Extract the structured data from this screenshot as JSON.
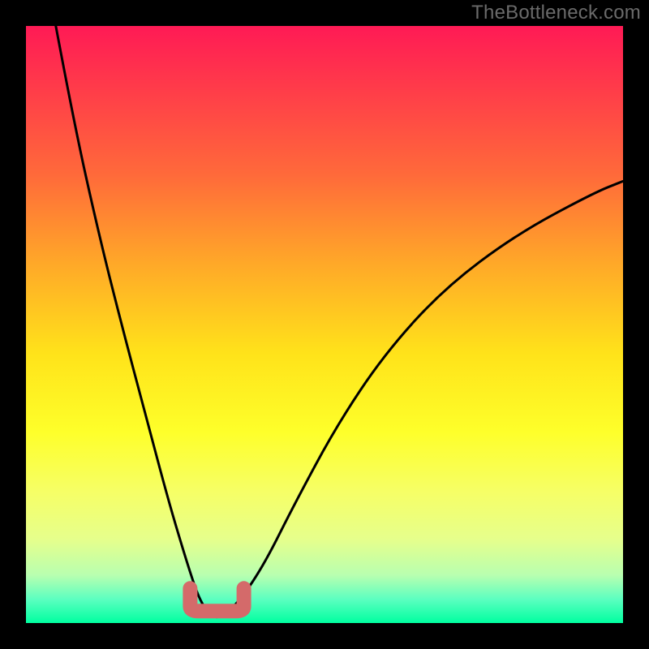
{
  "watermark": "TheBottleneck.com",
  "chart_data": {
    "type": "line",
    "title": "",
    "xlabel": "",
    "ylabel": "",
    "xlim": [
      0,
      100
    ],
    "ylim": [
      0,
      100
    ],
    "grid": false,
    "series": [
      {
        "name": "bottleneck-curve",
        "x": [
          5,
          8,
          12,
          16,
          20,
          24,
          27,
          29,
          31,
          33,
          36,
          40,
          45,
          52,
          60,
          70,
          82,
          95,
          100
        ],
        "values": [
          100,
          84,
          66,
          50,
          35,
          20,
          10,
          4,
          1,
          1,
          4,
          10,
          20,
          33,
          45,
          56,
          65,
          72,
          74
        ]
      }
    ],
    "annotations": [
      {
        "name": "trough-marker-band",
        "x_range": [
          27.5,
          36.5
        ],
        "y": 2
      },
      {
        "name": "left-cap-dot",
        "x": 27.3,
        "y": 5
      }
    ]
  }
}
